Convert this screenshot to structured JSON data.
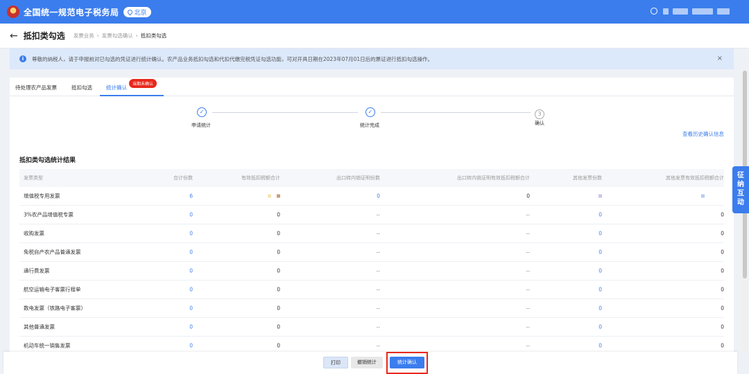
{
  "app": {
    "title": "全国统一规范电子税务局",
    "region": "北京"
  },
  "header": {
    "back_icon": "arrow-left-icon",
    "title": "抵扣类勾选",
    "breadcrumbs": [
      "发票业务",
      "发票勾选确认",
      "抵扣类勾选"
    ]
  },
  "notice": {
    "text": "尊敬的纳税人，请于申报前对已勾选的凭证进行统计确认。农产品业务抵扣勾选和代扣代缴完税凭证勾选功能，可对开具日期在2023年07月01日后的票证进行抵扣勾选操作。",
    "close": "×"
  },
  "tabs": [
    {
      "label": "待处理农产品发票"
    },
    {
      "label": "抵扣勾选"
    },
    {
      "label": "统计确认",
      "badge": "当期未确认"
    }
  ],
  "steps": [
    {
      "label": "申请统计",
      "mark": "✓"
    },
    {
      "label": "统计完成",
      "mark": "✓"
    },
    {
      "label": "确认",
      "mark": "3"
    }
  ],
  "history_link": "查看历史确认信息",
  "section_title": "抵扣类勾选统计结果",
  "table": {
    "columns": [
      "发票类型",
      "合计份数",
      "有效抵扣税额合计",
      "出口转内销证明份数",
      "出口转内销证明有效抵扣税额合计",
      "其他发票份数",
      "其他发票有效抵扣税额合计"
    ],
    "rows": [
      [
        "增值税专用发票",
        "6",
        "",
        "0",
        "0",
        "",
        ""
      ],
      [
        "3%农产品增值税专票",
        "0",
        "0",
        "--",
        "--",
        "0",
        "0"
      ],
      [
        "收购发票",
        "0",
        "0",
        "--",
        "--",
        "0",
        "0"
      ],
      [
        "免税自产农产品普通发票",
        "0",
        "0",
        "--",
        "--",
        "0",
        "0"
      ],
      [
        "通行费发票",
        "0",
        "0",
        "--",
        "--",
        "0",
        "0"
      ],
      [
        "航空运输电子客票行程单",
        "0",
        "0",
        "--",
        "--",
        "0",
        "0"
      ],
      [
        "数电发票（铁路电子客票）",
        "0",
        "0",
        "--",
        "--",
        "0",
        "0"
      ],
      [
        "其他普通发票",
        "0",
        "0",
        "--",
        "--",
        "0",
        "0"
      ],
      [
        "机动车统一销售发票",
        "0",
        "0",
        "--",
        "--",
        "0",
        "0"
      ]
    ]
  },
  "buttons": {
    "print": "打印",
    "revoke": "撤销统计",
    "confirm": "统计确认"
  },
  "float_tab": "征纳互动",
  "colors": {
    "primary": "#3b7ded",
    "badge": "#e8281c",
    "highlight": "#e8281c"
  }
}
